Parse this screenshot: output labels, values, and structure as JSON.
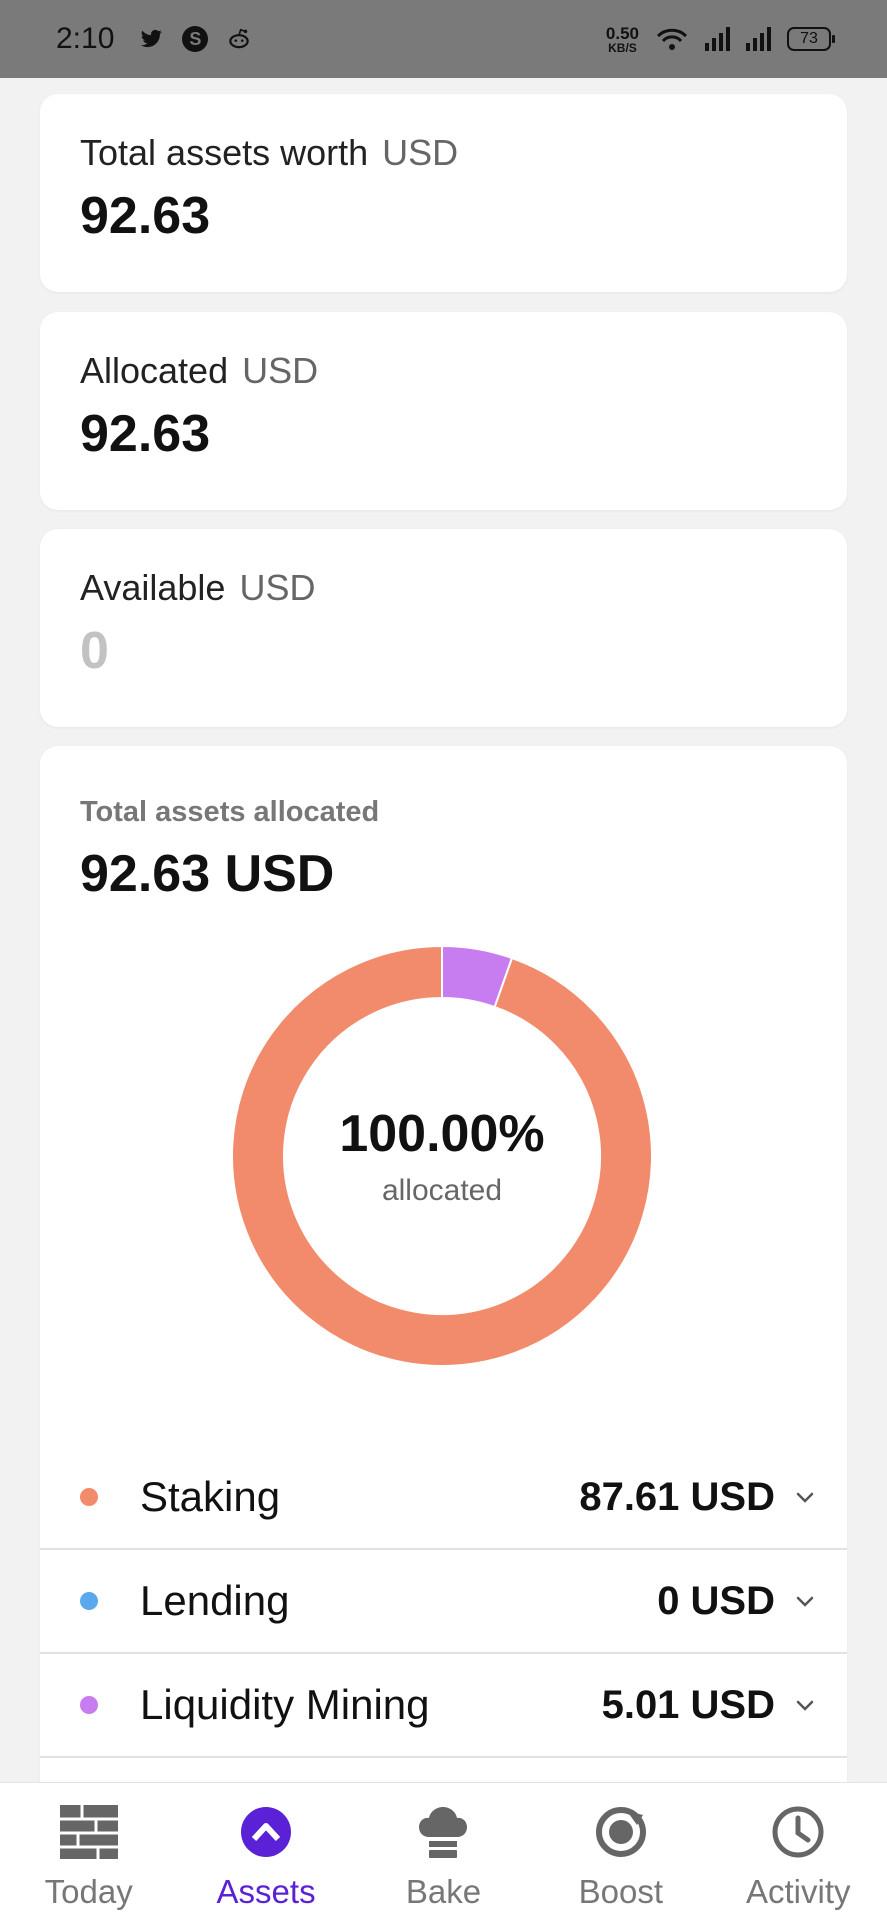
{
  "status_bar": {
    "time": "2:10",
    "net_speed_value": "0.50",
    "net_speed_unit": "KB/S",
    "battery": "73"
  },
  "cards": {
    "total_worth": {
      "label": "Total assets worth",
      "unit": "USD",
      "value": "92.63"
    },
    "allocated": {
      "label": "Allocated",
      "unit": "USD",
      "value": "92.63"
    },
    "available": {
      "label": "Available",
      "unit": "USD",
      "value": "0"
    }
  },
  "allocation": {
    "title": "Total assets allocated",
    "total": "92.63 USD",
    "percent": "100.00%",
    "percent_label": "allocated",
    "items": [
      {
        "name": "Staking",
        "amount": "87.61 USD",
        "color": "#f28b6c"
      },
      {
        "name": "Lending",
        "amount": "0 USD",
        "color": "#5aa9ee"
      },
      {
        "name": "Liquidity Mining",
        "amount": "5.01 USD",
        "color": "#c77cf0"
      }
    ]
  },
  "chart_data": {
    "type": "pie",
    "categories": [
      "Staking",
      "Lending",
      "Liquidity Mining"
    ],
    "values": [
      87.61,
      0,
      5.01
    ],
    "colors": [
      "#f28b6c",
      "#5aa9ee",
      "#c77cf0"
    ]
  },
  "tabbar": {
    "accent": "#5b21d6",
    "tabs": [
      {
        "label": "Today",
        "icon": "calendar-grid-icon"
      },
      {
        "label": "Assets",
        "icon": "assets-up-icon",
        "active": true
      },
      {
        "label": "Bake",
        "icon": "chef-hat-icon"
      },
      {
        "label": "Boost",
        "icon": "boost-ring-icon"
      },
      {
        "label": "Activity",
        "icon": "clock-icon"
      }
    ]
  }
}
